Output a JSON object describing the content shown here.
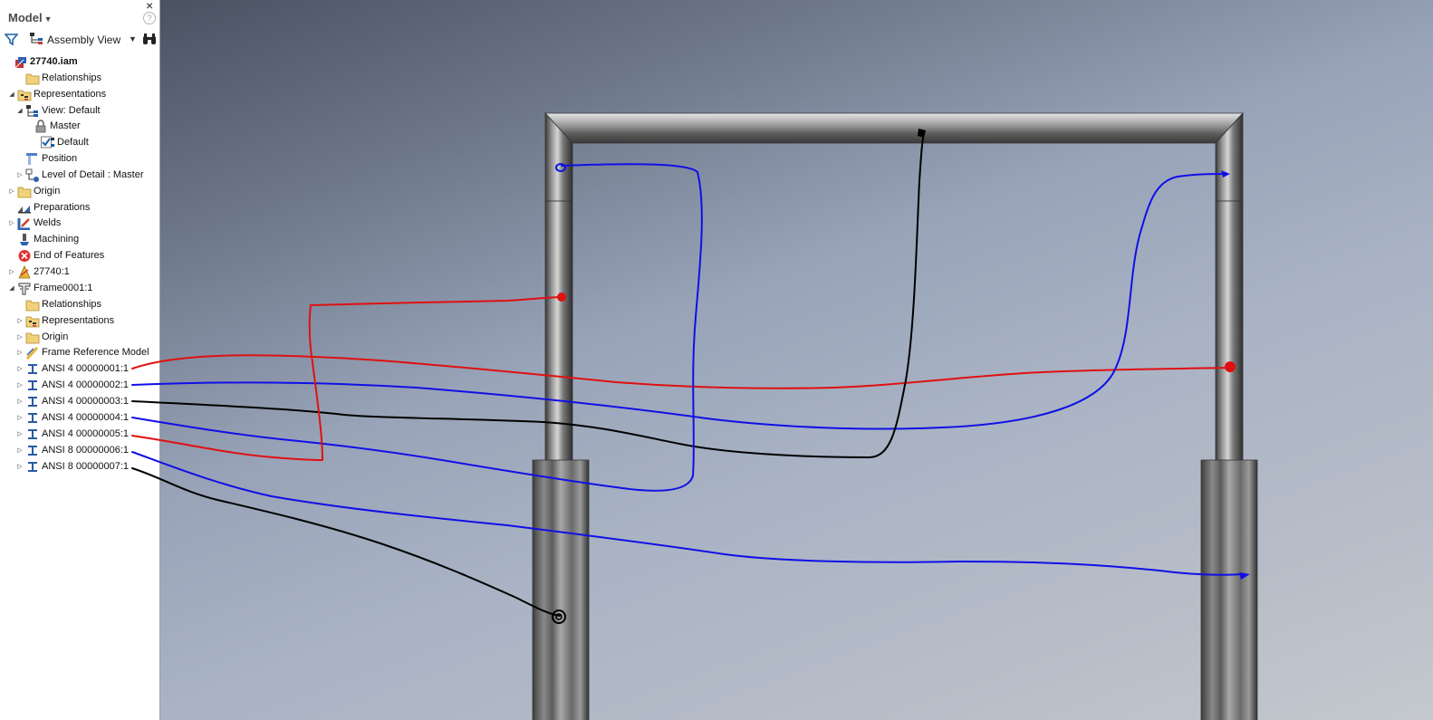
{
  "panel": {
    "title": "Model",
    "help": "?",
    "close": "×",
    "view_label": "Assembly View"
  },
  "tree": [
    {
      "label": "27740.iam",
      "expander": "",
      "icon": "assembly-icon",
      "bold": true
    },
    {
      "label": "Relationships",
      "expander": "",
      "icon": "folder-icon"
    },
    {
      "label": "Representations",
      "expander": "◢",
      "icon": "representations-icon"
    },
    {
      "label": "View: Default",
      "expander": "◢",
      "icon": "view-rep-icon"
    },
    {
      "label": "Master",
      "expander": "",
      "icon": "lock-icon"
    },
    {
      "label": "Default",
      "expander": "",
      "icon": "checked-view-icon"
    },
    {
      "label": "Position",
      "expander": "",
      "icon": "position-icon"
    },
    {
      "label": "Level of Detail : Master",
      "expander": "▷",
      "icon": "level-of-detail-icon"
    },
    {
      "label": "Origin",
      "expander": "▷",
      "icon": "folder-icon"
    },
    {
      "label": "Preparations",
      "expander": "",
      "icon": "preparations-icon"
    },
    {
      "label": "Welds",
      "expander": "▷",
      "icon": "welds-icon"
    },
    {
      "label": "Machining",
      "expander": "",
      "icon": "machining-icon"
    },
    {
      "label": "End of Features",
      "expander": "",
      "icon": "end-of-features-icon"
    },
    {
      "label": "27740:1",
      "expander": "▷",
      "icon": "weldment-icon"
    },
    {
      "label": "Frame0001:1",
      "expander": "◢",
      "icon": "frame-icon"
    },
    {
      "label": "Relationships",
      "expander": "",
      "icon": "folder-icon"
    },
    {
      "label": "Representations",
      "expander": "▷",
      "icon": "representations-icon"
    },
    {
      "label": "Origin",
      "expander": "▷",
      "icon": "folder-icon"
    },
    {
      "label": "Frame Reference Model",
      "expander": "▷",
      "icon": "frame-reference-icon"
    },
    {
      "label": "ANSI 4 00000001:1",
      "expander": "▷",
      "icon": "ibeam-icon"
    },
    {
      "label": "ANSI 4 00000002:1",
      "expander": "▷",
      "icon": "ibeam-icon"
    },
    {
      "label": "ANSI 4 00000003:1",
      "expander": "▷",
      "icon": "ibeam-icon"
    },
    {
      "label": "ANSI 4 00000004:1",
      "expander": "▷",
      "icon": "ibeam-icon"
    },
    {
      "label": "ANSI 4 00000005:1",
      "expander": "▷",
      "icon": "ibeam-icon"
    },
    {
      "label": "ANSI 8 00000006:1",
      "expander": "▷",
      "icon": "ibeam-icon"
    },
    {
      "label": "ANSI 8 00000007:1",
      "expander": "▷",
      "icon": "ibeam-icon"
    }
  ],
  "annotation_colors": {
    "red": "#e01010",
    "blue": "#1010e6",
    "black": "#000000"
  }
}
